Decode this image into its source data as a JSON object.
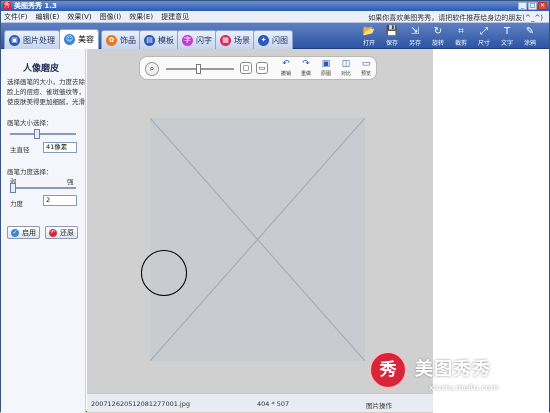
{
  "window": {
    "title": "美图秀秀 1.3",
    "controls": [
      "_",
      "□",
      "×"
    ]
  },
  "menu": {
    "items": [
      "文件(F)",
      "编辑(E)",
      "效果(V)",
      "图像(I)",
      "效果(E)",
      "提建意见"
    ],
    "promo": "如果你喜欢美图秀秀，请把软件推荐给身边的朋友(^_^)"
  },
  "tabs": [
    {
      "label": "图片处理",
      "color": "#2a5ab6"
    },
    {
      "label": "美容",
      "color": "#3a86d6"
    },
    {
      "label": "饰品",
      "color": "#e07d24"
    },
    {
      "label": "模板",
      "color": "#2a5ab6"
    },
    {
      "label": "闪字",
      "color": "#c43ad6"
    },
    {
      "label": "场景",
      "color": "#d62a5c"
    },
    {
      "label": "闪图",
      "color": "#2a5ab6"
    }
  ],
  "toolbar": [
    "打开",
    "保存",
    "另存",
    "旋转",
    "裁剪",
    "尺寸",
    "文字",
    "涂鸦"
  ],
  "left_panel": {
    "title": "人像磨皮",
    "description": "选择画笔的大小，力度去除脸上的痘痘、雀斑皱纹等，使皮肤美得更加细腻，光滑",
    "brush_size_label": "画笔大小选择：",
    "diameter_label": "主直径",
    "diameter_value": "41像素",
    "brush_strength_label": "画笔力度选择：",
    "weak_label": "弱",
    "strong_label": "强",
    "strength_label": "力度",
    "strength_value": "2",
    "apply_button": "启用",
    "undo_button": "还原"
  },
  "canvas_tools": [
    "撤销",
    "重做",
    "原图",
    "对比",
    "预览"
  ],
  "status": {
    "filename": "200712620512081277001.jpg",
    "dimensions": "404 * 507",
    "mode": "图片操作"
  },
  "watermark": {
    "seal": "秀",
    "brand": "美图秀秀",
    "url": "xiuxiu.meitu.com"
  }
}
